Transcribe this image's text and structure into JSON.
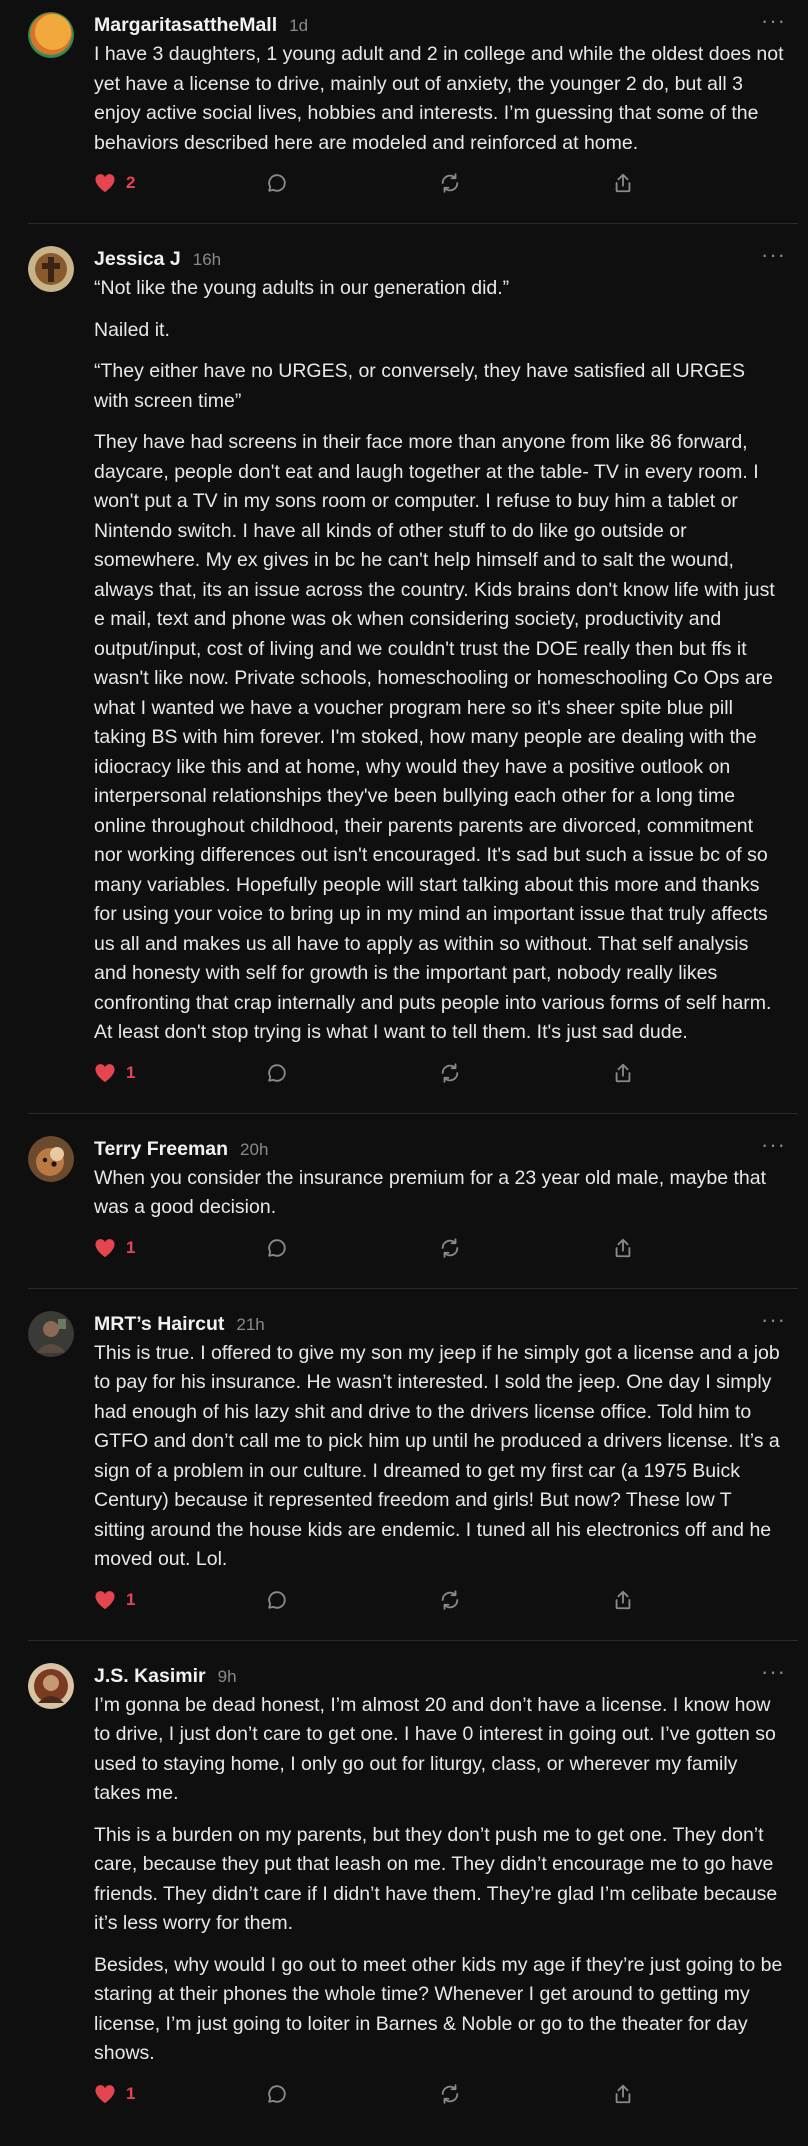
{
  "colors": {
    "background": "#0f0f0f",
    "like_accent": "#e5454f",
    "muted": "#8a8a8a"
  },
  "more_icon_glyph": "···",
  "comments": [
    {
      "author": "MargaritasattheMall",
      "time": "1d",
      "likes": "2",
      "avatar_icon": "orange-circle-avatar",
      "paragraphs": [
        "I have 3 daughters, 1 young adult and 2 in college and while the oldest does not yet have a license to drive, mainly out of anxiety, the younger 2 do, but all 3 enjoy active social lives, hobbies and interests. I’m guessing that some of the behaviors described here are modeled and reinforced at home."
      ]
    },
    {
      "author": "Jessica J",
      "time": "16h",
      "likes": "1",
      "avatar_icon": "cross-photo-avatar",
      "paragraphs": [
        "“Not like the young adults in our generation did.”",
        "Nailed it.",
        "“They either have no URGES, or conversely, they have satisfied all URGES with screen time”",
        "They have had screens in their face more than anyone from like 86 forward, daycare, people don't eat and laugh together at the table- TV in every room. I won't put a TV in my sons room or computer. I refuse to buy him a tablet or Nintendo switch. I have all kinds of other stuff to do like go outside or somewhere. My ex gives in bc he can't help himself and to salt the wound, always that, its an issue across the country. Kids brains don't know life with just e mail, text and phone was ok when considering society, productivity and output/input, cost of living and we couldn't trust the DOE really then but ffs it wasn't like now. Private schools, homeschooling or homeschooling Co Ops are what I wanted we have a voucher program here so it's sheer spite blue pill taking BS with him forever. I'm stoked, how many people are dealing with the idiocracy like this and at home, why would they have a positive outlook on interpersonal relationships they've been bullying each other for a long time online throughout childhood, their parents parents are divorced, commitment nor working differences out isn't encouraged. It's sad but such a issue bc of so many variables. Hopefully people will start talking about this more and thanks for using your voice to bring up in my mind an important issue that truly affects us all and makes us all have to apply as within so without. That self analysis and honesty with self for growth is the important part, nobody really likes confronting that crap internally and puts people into various forms of self harm. At least don't stop trying is what I want to tell them. It's just sad dude."
      ]
    },
    {
      "author": "Terry Freeman",
      "time": "20h",
      "likes": "1",
      "avatar_icon": "dog-photo-avatar",
      "paragraphs": [
        "When you consider the insurance premium for a 23 year old male, maybe that was a good decision."
      ]
    },
    {
      "author": "MRT’s Haircut",
      "time": "21h",
      "likes": "1",
      "avatar_icon": "person-photo-avatar",
      "paragraphs": [
        "This is true. I offered to give my son my jeep if he simply got a license and a job to pay for his insurance. He wasn’t interested. I sold the jeep. One day I simply had enough of his lazy shit and drive to the drivers license office. Told him to GTFO and don’t call me to pick him up until he produced a drivers license. It’s a sign of a problem in our culture. I dreamed to get my first car (a 1975 Buick Century) because it represented freedom and girls! But now? These low T sitting around the house kids are endemic. I tuned all his electronics off and he moved out. Lol."
      ]
    },
    {
      "author": "J.S. Kasimir",
      "time": "9h",
      "likes": "1",
      "avatar_icon": "portrait-photo-avatar",
      "paragraphs": [
        "I’m gonna be dead honest, I’m almost 20 and don’t have a license. I know how to drive, I just don’t care to get one. I have 0 interest in going out. I’ve gotten so used to staying home, I only go out for liturgy, class, or wherever my family takes me.",
        "This is a burden on my parents, but they don’t push me to get one. They don’t care, because they put that leash on me. They didn’t encourage me to go have friends. They didn’t care if I didn’t have them. They’re glad I’m celibate because it’s less worry for them.",
        "Besides, why would I go out to meet other kids my age if they’re just going to be staring at their phones the whole time? Whenever I get around to getting my license, I’m just going to loiter in Barnes & Noble or go to the theater for day shows."
      ]
    }
  ]
}
